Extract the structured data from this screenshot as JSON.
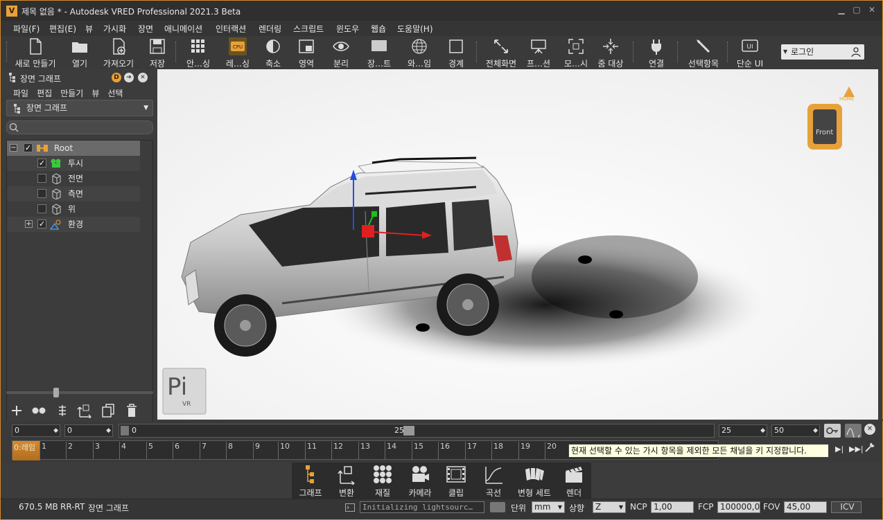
{
  "window": {
    "title": "제목 없음 * - Autodesk VRED Professional 2021.3 Beta",
    "app_icon": "V"
  },
  "menubar": [
    "파일(F)",
    "편집(E)",
    "뷰",
    "가시화",
    "장면",
    "애니메이션",
    "인터랙션",
    "렌더링",
    "스크립트",
    "윈도우",
    "웹숍",
    "도움말(H)"
  ],
  "toolbar": {
    "new": "새로 만들기",
    "open": "열기",
    "import": "가져오기",
    "save": "저장",
    "antialias": "안…싱",
    "raytracing": "레…싱",
    "cpu_badge": "CPU",
    "scale": "축소",
    "region": "영역",
    "split": "분리",
    "scene": "장…트",
    "wire": "와…임",
    "bounds": "경계",
    "fullscreen": "전체화면",
    "presentation": "프…션",
    "mode": "모…시",
    "zoom_target": "줌 대상",
    "connect": "연결",
    "selection": "선택항목",
    "simple_ui": "단순 UI",
    "ui_badge": "UI",
    "login": "로그인"
  },
  "scenegraph": {
    "title": "장면 그래프",
    "menu": [
      "파일",
      "편집",
      "만들기",
      "뷰",
      "선택"
    ],
    "combo_value": "장면 그래프",
    "items": [
      {
        "label": "Root",
        "checked": true
      },
      {
        "label": "투시",
        "checked": true
      },
      {
        "label": "전면",
        "checked": false
      },
      {
        "label": "측면",
        "checked": false
      },
      {
        "label": "위",
        "checked": false
      },
      {
        "label": "환경",
        "checked": true
      }
    ],
    "check_mark": "✓",
    "expand_minus": "−",
    "expand_plus": "+"
  },
  "viewport": {
    "cube_label": "Front",
    "home_label": "HOME",
    "logo_big": "Pi",
    "logo_small": "VR"
  },
  "timeline": {
    "field1": "0",
    "field2": "0",
    "range_start": "0",
    "range_end": "25",
    "field_end": "25",
    "field_total": "50",
    "frame_label": "0:레임",
    "ticks": [
      "1",
      "2",
      "3",
      "4",
      "5",
      "6",
      "7",
      "8",
      "9",
      "10",
      "11",
      "12",
      "13",
      "14",
      "15",
      "16",
      "17",
      "18",
      "19",
      "20"
    ],
    "tooltip": "현재 선택할 수 있는 가시 항목을 제외한 모든 채널을 키 지정합니다."
  },
  "bottom_tabs": [
    "그래프",
    "변환",
    "재질",
    "카메라",
    "클립",
    "곡선",
    "변형 세트",
    "렌더"
  ],
  "status": {
    "memory": "670.5 MB",
    "renderer": "RR-RT",
    "module": "장면 그래프",
    "message": "Initializing lightsourc…",
    "unit_label": "단위",
    "unit_value": "mm",
    "up_label": "상향",
    "up_value": "Z",
    "ncp_label": "NCP",
    "ncp_value": "1,00",
    "fcp_label": "FCP",
    "fcp_value": "100000,00",
    "fov_label": "FOV",
    "fov_value": "45,00",
    "icv": "ICV"
  },
  "colors": {
    "accent": "#d68a2a",
    "gizmo_x": "#e02020",
    "gizmo_y": "#20c020",
    "gizmo_z": "#2050e0"
  }
}
